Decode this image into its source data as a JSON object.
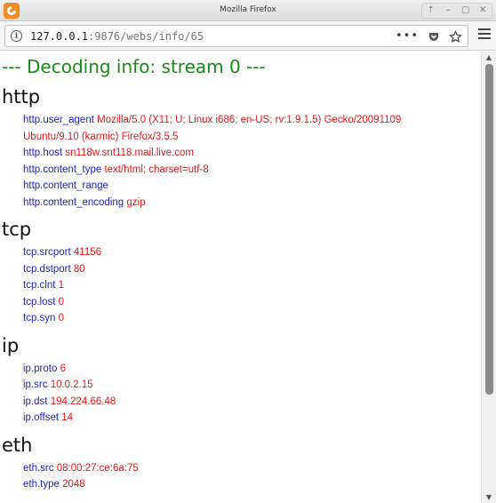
{
  "window": {
    "title": "Mozilla Firefox",
    "controls": [
      "⇡",
      "–",
      "▢",
      "✕"
    ]
  },
  "navbar": {
    "url_host": "127.0.0.1",
    "url_rest": ":9876/webs/info/65",
    "page_actions": "•••"
  },
  "page": {
    "heading": "--- Decoding info: stream 0 ---",
    "sections": [
      {
        "title": "http",
        "entries": [
          {
            "key": "http.user_agent",
            "value": "Mozilla/5.0 (X11; U; Linux i686; en-US; rv:1.9.1.5) Gecko/20091109 Ubuntu/9.10 (karmic) Firefox/3.5.5"
          },
          {
            "key": "http.host",
            "value": "sn118w.snt118.mail.live.com"
          },
          {
            "key": "http.content_type",
            "value": "text/html; charset=utf-8"
          },
          {
            "key": "http.content_range",
            "value": ""
          },
          {
            "key": "http.content_encoding",
            "value": "gzip"
          }
        ]
      },
      {
        "title": "tcp",
        "entries": [
          {
            "key": "tcp.srcport",
            "value": "41156"
          },
          {
            "key": "tcp.dstport",
            "value": "80"
          },
          {
            "key": "tcp.clnt",
            "value": "1"
          },
          {
            "key": "tcp.lost",
            "value": "0"
          },
          {
            "key": "tcp.syn",
            "value": "0"
          }
        ]
      },
      {
        "title": "ip",
        "entries": [
          {
            "key": "ip.proto",
            "value": "6"
          },
          {
            "key": "ip.src",
            "value": "10.0.2.15"
          },
          {
            "key": "ip.dst",
            "value": "194.224.66.48"
          },
          {
            "key": "ip.offset",
            "value": "14"
          }
        ]
      },
      {
        "title": "eth",
        "entries": [
          {
            "key": "eth.src",
            "value": "08:00:27:ce:6a:75"
          },
          {
            "key": "eth.type",
            "value": "2048"
          }
        ]
      }
    ]
  },
  "colors": {
    "heading": "#168b16",
    "key": "#2020cc",
    "value": "#e01818"
  }
}
